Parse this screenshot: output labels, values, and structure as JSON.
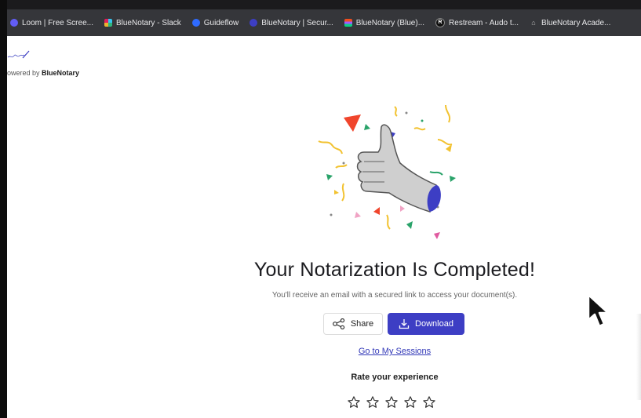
{
  "bookmarks": [
    {
      "label": "Loom | Free Scree...",
      "icon": "loom-icon",
      "color": "#625df5"
    },
    {
      "label": "BlueNotary - Slack",
      "icon": "slack-icon",
      "color": "#e01e5a"
    },
    {
      "label": "Guideflow",
      "icon": "guideflow-icon",
      "color": "#2f6bff"
    },
    {
      "label": "BlueNotary | Secur...",
      "icon": "bluenotary-icon",
      "color": "#3d3ec4"
    },
    {
      "label": "BlueNotary (Blue)...",
      "icon": "figma-icon",
      "color": "#a259ff"
    },
    {
      "label": "Restream - Audo t...",
      "icon": "restream-icon",
      "color": "#111111",
      "glyph": "R"
    },
    {
      "label": "BlueNotary Acade...",
      "icon": "academy-icon",
      "color": "#444444"
    }
  ],
  "brand": {
    "powered_prefix": "owered by",
    "powered_name": "BlueNotary"
  },
  "main": {
    "title": "Your Notarization Is Completed!",
    "subtitle": "You'll receive an email with a secured link to access your document(s).",
    "share_label": "Share",
    "download_label": "Download",
    "sessions_link": "Go to My Sessions",
    "rate_label": "Rate your experience",
    "rating_max": 5,
    "rating_value": 0
  },
  "colors": {
    "accent": "#3d3ec4",
    "link": "#3238b8",
    "bookmark_bar": "#35363a"
  }
}
